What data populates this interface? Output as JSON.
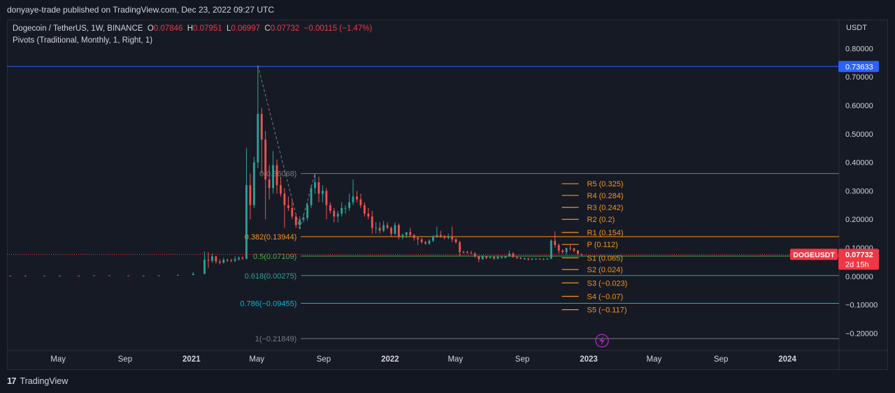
{
  "header": {
    "published": "donyaye-trade published on TradingView.com, Dec 23, 2022 09:27 UTC"
  },
  "legend": {
    "symbol": "Dogecoin / TetherUS, 1W, BINANCE",
    "o_label": "O",
    "o": "0.07846",
    "h_label": "H",
    "h": "0.07951",
    "l_label": "L",
    "l": "0.06997",
    "c_label": "C",
    "c": "0.07732",
    "change": "−0.00115 (−1.47%)",
    "indicator": "Pivots (Traditional, Monthly, 1, Right, 1)"
  },
  "footer": {
    "brand": "TradingView"
  },
  "colors": {
    "up": "#26a69a",
    "down": "#ef5350",
    "pivot": "#f7931a",
    "blue_line": "#2962ff",
    "price_tag": "#f23645"
  },
  "chart_data": {
    "type": "candlestick",
    "currency": "USDT",
    "x_ticks": [
      "May",
      "Sep",
      "2021",
      "May",
      "Sep",
      "2022",
      "May",
      "Sep",
      "2023",
      "May",
      "Sep",
      "2024"
    ],
    "x_tick_dates": [
      "2020-05-01",
      "2020-09-01",
      "2021-01-01",
      "2021-05-01",
      "2021-09-01",
      "2022-01-01",
      "2022-05-01",
      "2022-09-01",
      "2023-01-01",
      "2023-05-01",
      "2023-09-01",
      "2024-01-01"
    ],
    "y_ticks": [
      "0.80000",
      "0.70000",
      "0.60000",
      "0.50000",
      "0.40000",
      "0.30000",
      "0.20000",
      "0.10000",
      "0.00000",
      "−0.10000",
      "−0.20000"
    ],
    "y_tick_values": [
      0.8,
      0.7,
      0.6,
      0.5,
      0.4,
      0.3,
      0.2,
      0.1,
      0.0,
      -0.1,
      -0.2
    ],
    "ylim": [
      -0.255,
      0.835
    ],
    "xlim": [
      "2020-01-28",
      "2024-04-05"
    ],
    "candles": [
      [
        "2020-02-03",
        0.0026,
        0.0027,
        0.0024,
        0.0025
      ],
      [
        "2020-03-02",
        0.0025,
        0.0026,
        0.0016,
        0.0019
      ],
      [
        "2020-04-06",
        0.0019,
        0.0022,
        0.0018,
        0.0021
      ],
      [
        "2020-05-04",
        0.0021,
        0.0026,
        0.002,
        0.0025
      ],
      [
        "2020-06-08",
        0.0025,
        0.0027,
        0.0023,
        0.0024
      ],
      [
        "2020-07-06",
        0.0024,
        0.004,
        0.0023,
        0.0035
      ],
      [
        "2020-08-03",
        0.0035,
        0.0037,
        0.0029,
        0.0033
      ],
      [
        "2020-09-07",
        0.0033,
        0.0034,
        0.0024,
        0.0026
      ],
      [
        "2020-10-05",
        0.0026,
        0.0028,
        0.0025,
        0.0026
      ],
      [
        "2020-11-02",
        0.0026,
        0.0039,
        0.0025,
        0.0033
      ],
      [
        "2020-12-07",
        0.0033,
        0.006,
        0.003,
        0.0047
      ],
      [
        "2021-01-04",
        0.0047,
        0.015,
        0.0045,
        0.009
      ],
      [
        "2021-01-25",
        0.009,
        0.087,
        0.007,
        0.058
      ],
      [
        "2021-02-01",
        0.058,
        0.085,
        0.03,
        0.055
      ],
      [
        "2021-02-08",
        0.055,
        0.08,
        0.048,
        0.07
      ],
      [
        "2021-02-15",
        0.07,
        0.072,
        0.045,
        0.052
      ],
      [
        "2021-02-22",
        0.052,
        0.06,
        0.042,
        0.048
      ],
      [
        "2021-03-01",
        0.048,
        0.065,
        0.045,
        0.058
      ],
      [
        "2021-03-08",
        0.058,
        0.062,
        0.05,
        0.056
      ],
      [
        "2021-03-15",
        0.056,
        0.062,
        0.05,
        0.055
      ],
      [
        "2021-03-22",
        0.055,
        0.07,
        0.05,
        0.06
      ],
      [
        "2021-03-29",
        0.06,
        0.07,
        0.055,
        0.065
      ],
      [
        "2021-04-05",
        0.065,
        0.07,
        0.058,
        0.062
      ],
      [
        "2021-04-12",
        0.062,
        0.45,
        0.06,
        0.32
      ],
      [
        "2021-04-19",
        0.32,
        0.36,
        0.2,
        0.25
      ],
      [
        "2021-04-26",
        0.25,
        0.42,
        0.24,
        0.4
      ],
      [
        "2021-05-03",
        0.4,
        0.74,
        0.38,
        0.57
      ],
      [
        "2021-05-10",
        0.57,
        0.59,
        0.36,
        0.48
      ],
      [
        "2021-05-17",
        0.48,
        0.51,
        0.2,
        0.34
      ],
      [
        "2021-05-24",
        0.34,
        0.39,
        0.27,
        0.31
      ],
      [
        "2021-05-31",
        0.31,
        0.44,
        0.29,
        0.39
      ],
      [
        "2021-06-07",
        0.39,
        0.41,
        0.29,
        0.32
      ],
      [
        "2021-06-14",
        0.32,
        0.35,
        0.28,
        0.29
      ],
      [
        "2021-06-21",
        0.29,
        0.31,
        0.17,
        0.25
      ],
      [
        "2021-06-28",
        0.25,
        0.28,
        0.23,
        0.24
      ],
      [
        "2021-07-05",
        0.24,
        0.27,
        0.2,
        0.21
      ],
      [
        "2021-07-12",
        0.21,
        0.22,
        0.17,
        0.18
      ],
      [
        "2021-07-19",
        0.18,
        0.21,
        0.165,
        0.2
      ],
      [
        "2021-07-26",
        0.2,
        0.22,
        0.19,
        0.205
      ],
      [
        "2021-08-02",
        0.205,
        0.26,
        0.195,
        0.25
      ],
      [
        "2021-08-09",
        0.25,
        0.32,
        0.24,
        0.31
      ],
      [
        "2021-08-16",
        0.31,
        0.36,
        0.29,
        0.33
      ],
      [
        "2021-08-23",
        0.33,
        0.35,
        0.26,
        0.29
      ],
      [
        "2021-08-30",
        0.29,
        0.32,
        0.26,
        0.3
      ],
      [
        "2021-09-06",
        0.3,
        0.31,
        0.2,
        0.25
      ],
      [
        "2021-09-13",
        0.25,
        0.26,
        0.22,
        0.23
      ],
      [
        "2021-09-20",
        0.23,
        0.24,
        0.19,
        0.21
      ],
      [
        "2021-09-27",
        0.21,
        0.23,
        0.19,
        0.22
      ],
      [
        "2021-10-04",
        0.22,
        0.26,
        0.21,
        0.24
      ],
      [
        "2021-10-11",
        0.24,
        0.25,
        0.22,
        0.24
      ],
      [
        "2021-10-18",
        0.24,
        0.29,
        0.23,
        0.26
      ],
      [
        "2021-10-25",
        0.26,
        0.34,
        0.25,
        0.28
      ],
      [
        "2021-11-01",
        0.28,
        0.3,
        0.26,
        0.27
      ],
      [
        "2021-11-08",
        0.27,
        0.29,
        0.24,
        0.25
      ],
      [
        "2021-11-15",
        0.25,
        0.26,
        0.21,
        0.22
      ],
      [
        "2021-11-22",
        0.22,
        0.24,
        0.2,
        0.21
      ],
      [
        "2021-11-29",
        0.21,
        0.23,
        0.15,
        0.17
      ],
      [
        "2021-12-06",
        0.17,
        0.19,
        0.15,
        0.17
      ],
      [
        "2021-12-13",
        0.17,
        0.19,
        0.15,
        0.16
      ],
      [
        "2021-12-20",
        0.16,
        0.195,
        0.155,
        0.18
      ],
      [
        "2021-12-27",
        0.18,
        0.19,
        0.165,
        0.17
      ],
      [
        "2022-01-03",
        0.17,
        0.175,
        0.14,
        0.15
      ],
      [
        "2022-01-10",
        0.15,
        0.19,
        0.145,
        0.18
      ],
      [
        "2022-01-17",
        0.18,
        0.185,
        0.13,
        0.14
      ],
      [
        "2022-01-24",
        0.14,
        0.15,
        0.13,
        0.145
      ],
      [
        "2022-01-31",
        0.145,
        0.155,
        0.135,
        0.155
      ],
      [
        "2022-02-07",
        0.155,
        0.17,
        0.14,
        0.145
      ],
      [
        "2022-02-14",
        0.145,
        0.148,
        0.125,
        0.135
      ],
      [
        "2022-02-21",
        0.135,
        0.14,
        0.11,
        0.13
      ],
      [
        "2022-02-28",
        0.13,
        0.135,
        0.115,
        0.12
      ],
      [
        "2022-03-07",
        0.12,
        0.125,
        0.11,
        0.115
      ],
      [
        "2022-03-14",
        0.115,
        0.13,
        0.11,
        0.125
      ],
      [
        "2022-03-21",
        0.125,
        0.145,
        0.12,
        0.14
      ],
      [
        "2022-03-28",
        0.14,
        0.175,
        0.135,
        0.145
      ],
      [
        "2022-04-04",
        0.145,
        0.16,
        0.135,
        0.14
      ],
      [
        "2022-04-11",
        0.14,
        0.145,
        0.13,
        0.135
      ],
      [
        "2022-04-18",
        0.135,
        0.15,
        0.13,
        0.14
      ],
      [
        "2022-04-25",
        0.14,
        0.175,
        0.12,
        0.13
      ],
      [
        "2022-05-02",
        0.13,
        0.135,
        0.115,
        0.12
      ],
      [
        "2022-05-09",
        0.12,
        0.125,
        0.07,
        0.085
      ],
      [
        "2022-05-16",
        0.085,
        0.09,
        0.08,
        0.085
      ],
      [
        "2022-05-23",
        0.085,
        0.09,
        0.08,
        0.082
      ],
      [
        "2022-05-30",
        0.082,
        0.09,
        0.078,
        0.08
      ],
      [
        "2022-06-06",
        0.08,
        0.085,
        0.065,
        0.07
      ],
      [
        "2022-06-13",
        0.07,
        0.072,
        0.05,
        0.06
      ],
      [
        "2022-06-20",
        0.06,
        0.075,
        0.058,
        0.07
      ],
      [
        "2022-06-27",
        0.07,
        0.072,
        0.06,
        0.065
      ],
      [
        "2022-07-04",
        0.065,
        0.072,
        0.062,
        0.068
      ],
      [
        "2022-07-11",
        0.068,
        0.07,
        0.058,
        0.062
      ],
      [
        "2022-07-18",
        0.062,
        0.075,
        0.06,
        0.068
      ],
      [
        "2022-07-25",
        0.068,
        0.07,
        0.062,
        0.065
      ],
      [
        "2022-08-01",
        0.065,
        0.072,
        0.063,
        0.07
      ],
      [
        "2022-08-08",
        0.07,
        0.09,
        0.068,
        0.08
      ],
      [
        "2022-08-15",
        0.08,
        0.085,
        0.065,
        0.068
      ],
      [
        "2022-08-22",
        0.068,
        0.07,
        0.06,
        0.065
      ],
      [
        "2022-08-29",
        0.065,
        0.068,
        0.06,
        0.062
      ],
      [
        "2022-09-05",
        0.062,
        0.066,
        0.058,
        0.063
      ],
      [
        "2022-09-12",
        0.063,
        0.065,
        0.056,
        0.06
      ],
      [
        "2022-09-19",
        0.06,
        0.065,
        0.057,
        0.061
      ],
      [
        "2022-09-26",
        0.061,
        0.064,
        0.058,
        0.062
      ],
      [
        "2022-10-03",
        0.062,
        0.064,
        0.058,
        0.06
      ],
      [
        "2022-10-10",
        0.06,
        0.064,
        0.057,
        0.061
      ],
      [
        "2022-10-17",
        0.061,
        0.064,
        0.058,
        0.062
      ],
      [
        "2022-10-24",
        0.062,
        0.13,
        0.06,
        0.125
      ],
      [
        "2022-10-31",
        0.125,
        0.158,
        0.1,
        0.11
      ],
      [
        "2022-11-07",
        0.11,
        0.115,
        0.08,
        0.09
      ],
      [
        "2022-11-14",
        0.09,
        0.095,
        0.08,
        0.085
      ],
      [
        "2022-11-21",
        0.085,
        0.1,
        0.077,
        0.1
      ],
      [
        "2022-11-28",
        0.1,
        0.11,
        0.09,
        0.098
      ],
      [
        "2022-12-05",
        0.098,
        0.1,
        0.085,
        0.09
      ],
      [
        "2022-12-12",
        0.09,
        0.093,
        0.075,
        0.0785
      ],
      [
        "2022-12-19",
        0.07846,
        0.07951,
        0.06997,
        0.07732
      ]
    ],
    "current_price": {
      "label": "DOGEUSDT",
      "value": "0.07732",
      "countdown": "2d 15h",
      "y": 0.07732
    },
    "ath_line": {
      "label": "0.73633",
      "y": 0.73633
    },
    "fib_levels": [
      {
        "label": "0(0.36068)",
        "y": 0.36068,
        "color": "#787b86"
      },
      {
        "label": "0.382(0.13944)",
        "y": 0.13944,
        "color": "#f7931a"
      },
      {
        "label": "0.5(0.07109)",
        "y": 0.07109,
        "color": "#4caf50"
      },
      {
        "label": "0.618(0.00275)",
        "y": 0.00275,
        "color": "#26a69a"
      },
      {
        "label": "0.786(−0.09455)",
        "y": -0.09455,
        "color": "#00bcd4"
      },
      {
        "label": "1(−0.21849)",
        "y": -0.21849,
        "color": "#787b86"
      }
    ],
    "pivots": [
      {
        "label": "R5 (0.325)",
        "y": 0.325
      },
      {
        "label": "R4 (0.284)",
        "y": 0.284
      },
      {
        "label": "R3 (0.242)",
        "y": 0.242
      },
      {
        "label": "R2 (0.2)",
        "y": 0.2
      },
      {
        "label": "R1 (0.154)",
        "y": 0.154
      },
      {
        "label": "P (0.112)",
        "y": 0.112
      },
      {
        "label": "S1 (0.065)",
        "y": 0.065
      },
      {
        "label": "S2 (0.024)",
        "y": 0.024
      },
      {
        "label": "S3 (−0.023)",
        "y": -0.023
      },
      {
        "label": "S4 (−0.07)",
        "y": -0.07
      },
      {
        "label": "S5 (−0.117)",
        "y": -0.117
      }
    ],
    "trend_line": {
      "from": [
        "2021-05-03",
        0.74
      ],
      "to": [
        "2021-07-19",
        0.165
      ]
    },
    "trend_line2": {
      "from": [
        "2021-07-19",
        0.165
      ],
      "to": [
        "2021-08-16",
        0.36068
      ]
    }
  }
}
